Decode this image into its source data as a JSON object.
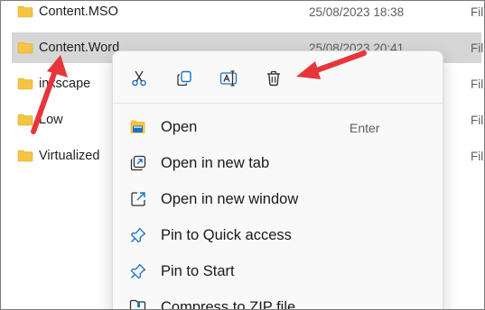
{
  "files": [
    {
      "name": "Content.MSO",
      "date": "25/08/2023 18:38",
      "type": "Fil",
      "selected": false
    },
    {
      "name": "Content.Word",
      "date": "25/08/2023 20:41",
      "type": "Fil",
      "selected": true
    },
    {
      "name": "inkscape",
      "date": "",
      "type": "Fil",
      "selected": false
    },
    {
      "name": "Low",
      "date": "",
      "type": "Fil",
      "selected": false
    },
    {
      "name": "Virtualized",
      "date": "",
      "type": "Fil",
      "selected": false
    }
  ],
  "quick_actions": [
    {
      "name": "cut",
      "icon": "scissors-icon"
    },
    {
      "name": "copy",
      "icon": "copy-icon"
    },
    {
      "name": "rename",
      "icon": "rename-icon"
    },
    {
      "name": "delete",
      "icon": "trash-icon"
    }
  ],
  "menu_items": [
    {
      "label": "Open",
      "shortcut": "Enter",
      "icon": "folder-open-icon"
    },
    {
      "label": "Open in new tab",
      "shortcut": "",
      "icon": "new-tab-icon"
    },
    {
      "label": "Open in new window",
      "shortcut": "",
      "icon": "new-window-icon"
    },
    {
      "label": "Pin to Quick access",
      "shortcut": "",
      "icon": "pin-icon"
    },
    {
      "label": "Pin to Start",
      "shortcut": "",
      "icon": "pin-icon"
    },
    {
      "label": "Compress to ZIP file",
      "shortcut": "",
      "icon": "zip-icon"
    }
  ],
  "colors": {
    "folder": "#f4c542",
    "accent": "#1a73c8",
    "annotation_arrow": "#e8353b",
    "selection": "#d6d6d6"
  }
}
